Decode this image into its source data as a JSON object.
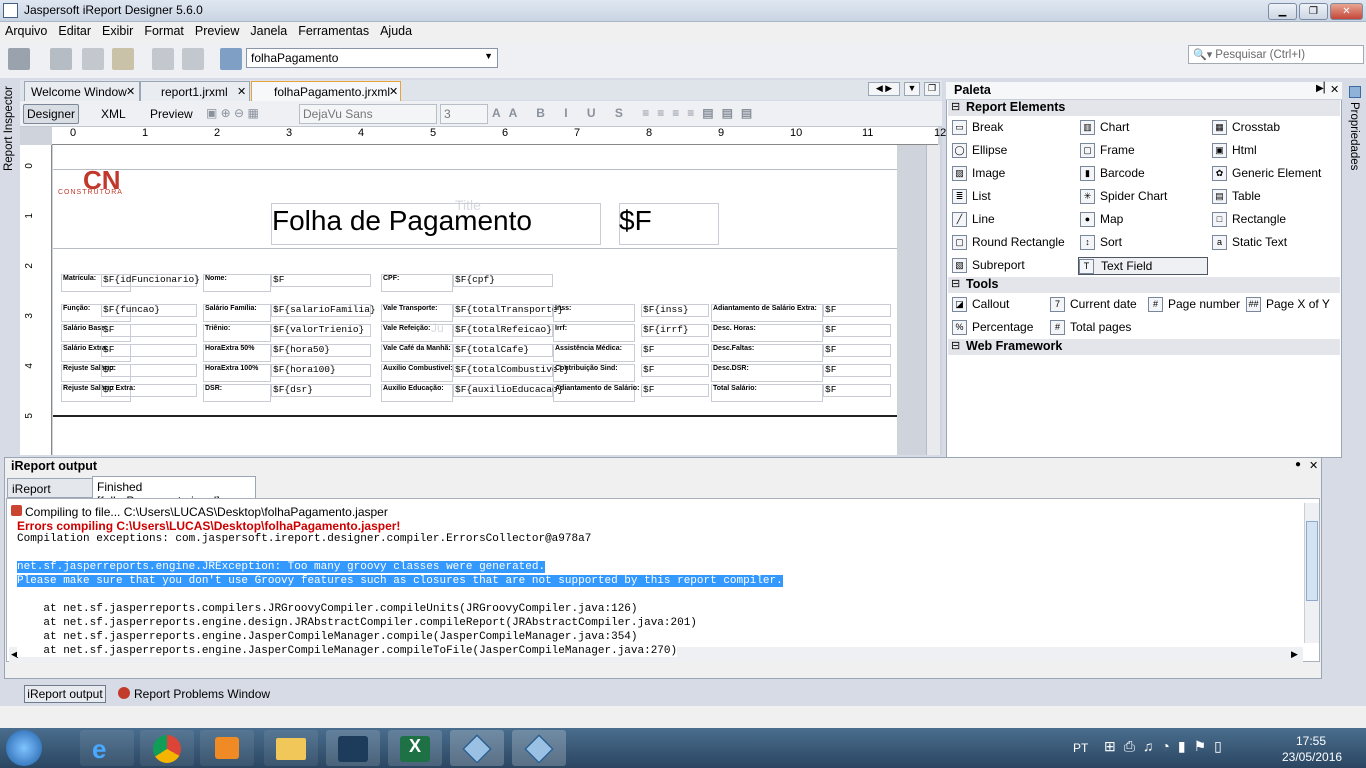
{
  "window": {
    "title": "Jaspersoft iReport Designer 5.6.0"
  },
  "menu": [
    "Arquivo",
    "Editar",
    "Exibir",
    "Format",
    "Preview",
    "Janela",
    "Ferramentas",
    "Ajuda"
  ],
  "toolbar": {
    "report_combo": "folhaPagamento",
    "search_placeholder": "Pesquisar (Ctrl+I)"
  },
  "side": {
    "inspector": "Report Inspector",
    "properties": "Propriedades"
  },
  "tabs": [
    "Welcome Window",
    "report1.jrxml",
    "folhaPagamento.jrxml"
  ],
  "editor": {
    "modes": [
      "Designer",
      "XML",
      "Preview"
    ],
    "font": "DejaVu Sans",
    "size": "3"
  },
  "ruler": [
    "0",
    "1",
    "2",
    "3",
    "4",
    "5",
    "6",
    "7",
    "8",
    "9",
    "10",
    "11",
    "12"
  ],
  "vruler": [
    "0",
    "1",
    "2",
    "3",
    "4",
    "5"
  ],
  "report": {
    "logo": "CN",
    "logo_sub": "CONSTRUTORA",
    "title": "Folha de Pagamento",
    "title_field": "$F",
    "band_title": "Title",
    "band_hint": "Ju",
    "rows": [
      {
        "l1": "Matrícula:",
        "v1": "$F{idFuncionario}",
        "l2": "Nome:",
        "v2": "$F",
        "l3": "CPF:",
        "v3": "$F{cpf}"
      },
      {
        "l1": "Função:",
        "v1": "$F{funcao}",
        "l2": "Salário Família:",
        "v2": "$F{salarioFamilia}",
        "l3": "Vale Transporte:",
        "v3": "$F{totalTransporte}",
        "l4": "Inss:",
        "v4": "$F{inss}",
        "l5": "Adiantamento de Salário Extra:",
        "v5": "$F"
      },
      {
        "l1": "Salário Base:",
        "v1": "$F",
        "l2": "Triênio:",
        "v2": "$F{valorTrienio}",
        "l3": "Vale Refeição:",
        "v3": "$F{totalRefeicao}",
        "l4": "Irrf:",
        "v4": "$F{irrf}",
        "l5": "Desc. Horas:",
        "v5": "$F"
      },
      {
        "l1": "Salário Extra:",
        "v1": "$F",
        "l2": "HoraExtra 50%",
        "v2": "$F{hora50}",
        "l3": "Vale Café da Manhã:",
        "v3": "$F{totalCafe}",
        "l4": "Assistência Médica:",
        "v4": "$F",
        "l5": "Desc.Faltas:",
        "v5": "$F"
      },
      {
        "l1": "Rejuste Salário:",
        "v1": "$F",
        "l2": "HoraExtra 100%",
        "v2": "$F{hora100}",
        "l3": "Auxilio Combustivel:",
        "v3": "$F{totalCombustivel}",
        "l4": "Contribuição Sind:",
        "v4": "$F",
        "l5": "Desc.DSR:",
        "v5": "$F"
      },
      {
        "l1": "Rejuste Salário Extra:",
        "v1": "$F",
        "l2": "DSR:",
        "v2": "$F{dsr}",
        "l3": "Auxilio Educação:",
        "v3": "$F{auxilioEducacao}",
        "l4": "Adiantamento de Salário:",
        "v4": "$F",
        "l5": "Total Salário:",
        "v5": "$F"
      }
    ]
  },
  "palette": {
    "title": "Paleta",
    "sections": [
      "Report Elements",
      "Tools",
      "Web Framework"
    ],
    "elements": [
      [
        "Break",
        "Chart",
        "Crosstab"
      ],
      [
        "Ellipse",
        "Frame",
        "Html"
      ],
      [
        "Image",
        "Barcode",
        "Generic Element"
      ],
      [
        "List",
        "Spider Chart",
        "Table"
      ],
      [
        "Line",
        "Map",
        "Rectangle"
      ],
      [
        "Round Rectangle",
        "Sort",
        "Static Text"
      ],
      [
        "Subreport",
        "Text Field",
        ""
      ]
    ],
    "tools": [
      [
        "Callout",
        "Current date",
        "Page number",
        "Page X of Y"
      ],
      [
        "Percentage",
        "Total pages",
        "",
        ""
      ]
    ],
    "static_icon": "label"
  },
  "output": {
    "title": "iReport output",
    "tabs": [
      "iReport console",
      "Finished [folhaPagamento.jrxml]"
    ],
    "lines": [
      "Compiling to file... C:\\Users\\LUCAS\\Desktop\\folhaPagamento.jasper",
      "Errors compiling C:\\Users\\LUCAS\\Desktop\\folhaPagamento.jasper!",
      "Compilation exceptions: com.jaspersoft.ireport.designer.compiler.ErrorsCollector@a978a7",
      "net.sf.jasperreports.engine.JRException: Too many groovy classes were generated.",
      "Please make sure that you don't use Groovy features such as closures that are not supported by this report compiler.",
      "    at net.sf.jasperreports.compilers.JRGroovyCompiler.compileUnits(JRGroovyCompiler.java:126)",
      "    at net.sf.jasperreports.engine.design.JRAbstractCompiler.compileReport(JRAbstractCompiler.java:201)",
      "    at net.sf.jasperreports.engine.JasperCompileManager.compile(JasperCompileManager.java:354)",
      "    at net.sf.jasperreports.engine.JasperCompileManager.compileToFile(JasperCompileManager.java:270)"
    ]
  },
  "status": {
    "output_btn": "iReport output",
    "problems": "Report Problems Window"
  },
  "tray": {
    "lang": "PT",
    "time": "17:55",
    "date": "23/05/2016"
  },
  "colors": {
    "error": "#cc0000",
    "selection": "#3399ff",
    "logo": "#c0392b"
  }
}
